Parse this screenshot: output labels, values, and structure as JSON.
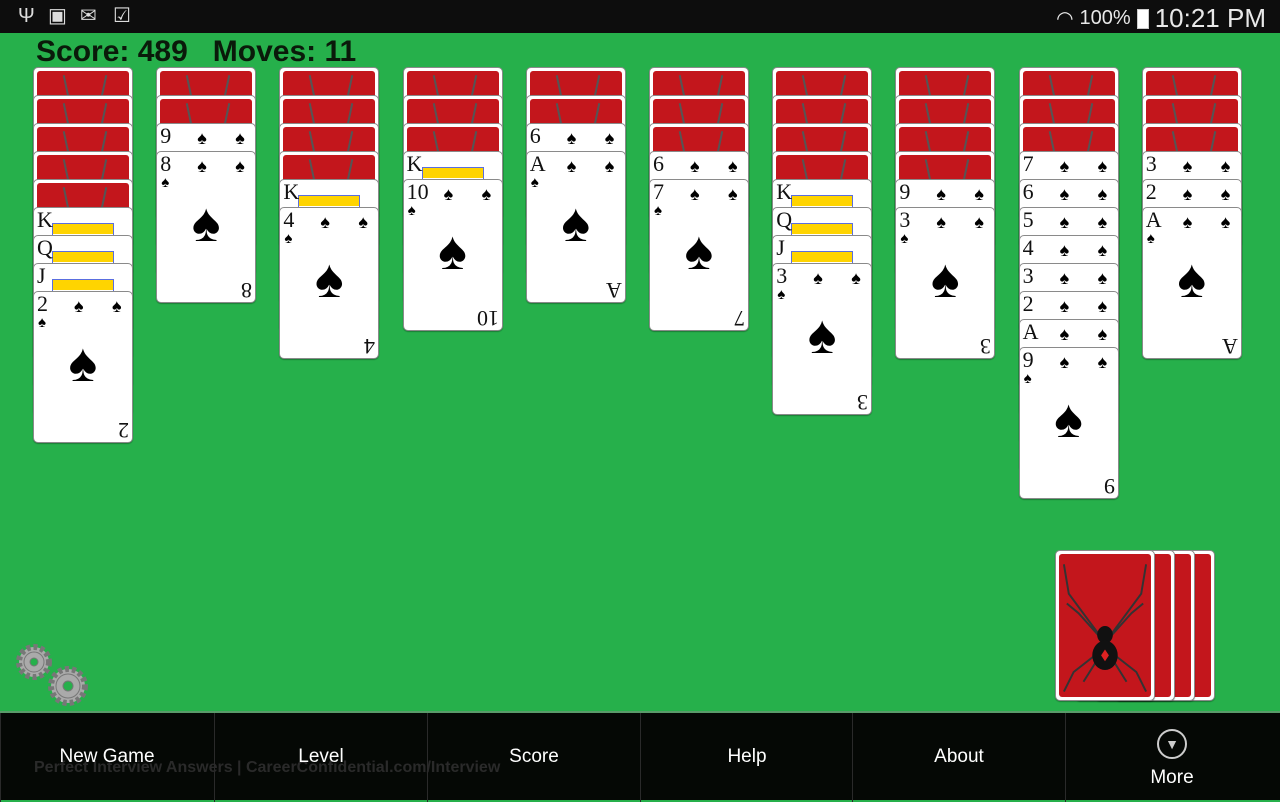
{
  "status_bar": {
    "left_icons": [
      "usb-icon",
      "gallery-icon",
      "gmail-icon",
      "task-icon"
    ],
    "wifi": "wifi-icon",
    "battery_percent": "100%",
    "time": "10:21 PM"
  },
  "game": {
    "score_label": "Score: 489",
    "moves_label": "Moves: 11",
    "suit": "♠",
    "columns": [
      {
        "face_down": 5,
        "face_up": [
          "K",
          "Q",
          "J",
          "2"
        ]
      },
      {
        "face_down": 2,
        "face_up": [
          "9",
          "8"
        ]
      },
      {
        "face_down": 4,
        "face_up": [
          "K",
          "4"
        ]
      },
      {
        "face_down": 3,
        "face_up": [
          "K",
          "10"
        ]
      },
      {
        "face_down": 2,
        "face_up": [
          "6",
          "A"
        ]
      },
      {
        "face_down": 3,
        "face_up": [
          "6",
          "7"
        ]
      },
      {
        "face_down": 4,
        "face_up": [
          "K",
          "Q",
          "J",
          "3"
        ]
      },
      {
        "face_down": 4,
        "face_up": [
          "9",
          "3"
        ]
      },
      {
        "face_down": 3,
        "face_up": [
          "7",
          "6",
          "5",
          "4",
          "3",
          "2",
          "A",
          "9"
        ]
      },
      {
        "face_down": 3,
        "face_up": [
          "3",
          "2",
          "A"
        ]
      }
    ],
    "stock_piles": 4,
    "card_back_color": "#c3161c",
    "table_color": "#26b04b"
  },
  "menu": {
    "items": [
      "New Game",
      "Level",
      "Score",
      "Help",
      "About",
      "More"
    ],
    "ad_text": "Perfect Interview Answers | CareerConfidential.com/Interview"
  }
}
